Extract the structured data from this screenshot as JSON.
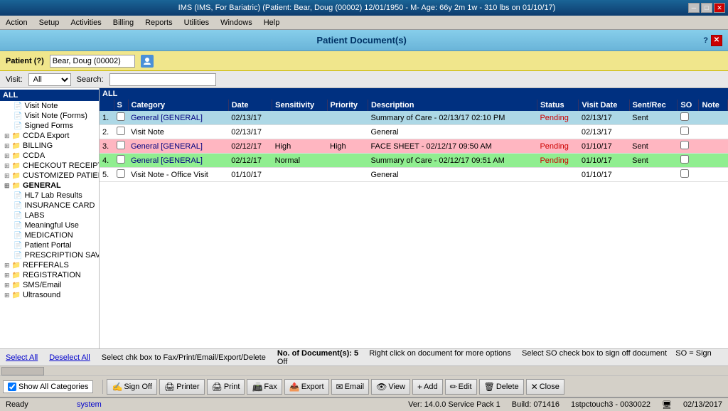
{
  "titlebar": {
    "text": "IMS (IMS, For Bariatric)   (Patient: Bear, Doug  (00002) 12/01/1950 - M- Age: 66y 2m 1w - 310 lbs on 01/10/17)",
    "minimize": "─",
    "restore": "□",
    "close": "✕"
  },
  "menubar": {
    "items": [
      "Action",
      "Setup",
      "Activities",
      "Billing",
      "Reports",
      "Utilities",
      "Windows",
      "Help"
    ]
  },
  "dialog": {
    "title": "Patient Document(s)",
    "help": "?",
    "close": "✕"
  },
  "patient": {
    "label": "Patient (?)",
    "value": "Bear, Doug (00002)"
  },
  "visit": {
    "label": "Visit:",
    "value": "All",
    "search_label": "Search:",
    "search_value": ""
  },
  "sidebar": {
    "all_label": "ALL",
    "items": [
      {
        "label": "Visit Note",
        "indent": 1,
        "bold": false
      },
      {
        "label": "Visit Note (Forms)",
        "indent": 1,
        "bold": false
      },
      {
        "label": "Signed Forms",
        "indent": 1,
        "bold": false
      },
      {
        "label": "CCDA Export",
        "indent": 0,
        "bold": false
      },
      {
        "label": "BILLING",
        "indent": 0,
        "bold": false
      },
      {
        "label": "CCDA",
        "indent": 0,
        "bold": false
      },
      {
        "label": "CHECKOUT RECEIPT",
        "indent": 0,
        "bold": false
      },
      {
        "label": "CUSTOMIZED PATIENT",
        "indent": 0,
        "bold": false
      },
      {
        "label": "GENERAL",
        "indent": 0,
        "bold": true
      },
      {
        "label": "HL7 Lab Results",
        "indent": 1,
        "bold": false
      },
      {
        "label": "INSURANCE CARD",
        "indent": 1,
        "bold": false
      },
      {
        "label": "LABS",
        "indent": 1,
        "bold": false
      },
      {
        "label": "Meaningful Use",
        "indent": 1,
        "bold": false
      },
      {
        "label": "MEDICATION",
        "indent": 1,
        "bold": false
      },
      {
        "label": "Patient Portal",
        "indent": 1,
        "bold": false
      },
      {
        "label": "PRESCRIPTION SAVING",
        "indent": 1,
        "bold": false
      },
      {
        "label": "REFFERALS",
        "indent": 0,
        "bold": false
      },
      {
        "label": "REGISTRATION",
        "indent": 0,
        "bold": false
      },
      {
        "label": "SMS/Email",
        "indent": 0,
        "bold": false
      },
      {
        "label": "Ultrasound",
        "indent": 0,
        "bold": false
      }
    ]
  },
  "table": {
    "all_label": "ALL",
    "columns": [
      "",
      "S",
      "Category",
      "Date",
      "Sensitivity",
      "Priority",
      "Description",
      "Status",
      "Visit Date",
      "Sent/Rec",
      "SO",
      "Note"
    ],
    "rows": [
      {
        "num": "1.",
        "checked": false,
        "category": "General [GENERAL]",
        "date": "02/13/17",
        "sensitivity": "",
        "priority": "",
        "description": "Summary of Care - 02/13/17 02:10 PM",
        "status": "Pending",
        "visit_date": "02/13/17",
        "sent_rec": "Sent",
        "so": false,
        "note": "",
        "color": "blue"
      },
      {
        "num": "2.",
        "checked": false,
        "category": "Visit Note",
        "date": "02/13/17",
        "sensitivity": "",
        "priority": "",
        "description": "General",
        "status": "",
        "visit_date": "02/13/17",
        "sent_rec": "",
        "so": false,
        "note": "",
        "color": "white"
      },
      {
        "num": "3.",
        "checked": false,
        "category": "General [GENERAL]",
        "date": "02/12/17",
        "sensitivity": "High",
        "priority": "High",
        "description": "FACE SHEET - 02/12/17 09:50 AM",
        "status": "Pending",
        "visit_date": "01/10/17",
        "sent_rec": "Sent",
        "so": false,
        "note": "",
        "color": "pink"
      },
      {
        "num": "4.",
        "checked": false,
        "category": "General [GENERAL]",
        "date": "02/12/17",
        "sensitivity": "Normal",
        "priority": "",
        "description": "Summary of Care - 02/12/17 09:51 AM",
        "status": "Pending",
        "visit_date": "01/10/17",
        "sent_rec": "Sent",
        "so": false,
        "note": "",
        "color": "green"
      },
      {
        "num": "5.",
        "checked": false,
        "category": "Visit Note - Office Visit",
        "date": "01/10/17",
        "sensitivity": "",
        "priority": "",
        "description": "General",
        "status": "",
        "visit_date": "01/10/17",
        "sent_rec": "",
        "so": false,
        "note": "",
        "color": "white"
      }
    ]
  },
  "status_bar": {
    "select_all": "Select All",
    "deselect_all": "Deselect All",
    "instruction": "Select chk box to Fax/Print/Email/Export/Delete",
    "count_label": "No. of Document(s):",
    "count": "5",
    "right_click_info": "Right click on document for more options",
    "so_info": "Select SO check box to sign off document",
    "so_legend": "SO = Sign Off"
  },
  "buttons": [
    {
      "label": "Show All Categories",
      "icon": "☑",
      "name": "show-all-categories"
    },
    {
      "label": "Sign Off",
      "icon": "✍",
      "name": "sign-off"
    },
    {
      "label": "Printer",
      "icon": "🖨",
      "name": "printer"
    },
    {
      "label": "Print",
      "icon": "🖨",
      "name": "print"
    },
    {
      "label": "Fax",
      "icon": "📠",
      "name": "fax"
    },
    {
      "label": "Export",
      "icon": "📤",
      "name": "export"
    },
    {
      "label": "Email",
      "icon": "✉",
      "name": "email"
    },
    {
      "label": "View",
      "icon": "👁",
      "name": "view"
    },
    {
      "label": "Add",
      "icon": "+",
      "name": "add"
    },
    {
      "label": "Edit",
      "icon": "✏",
      "name": "edit"
    },
    {
      "label": "Delete",
      "icon": "🗑",
      "name": "delete"
    },
    {
      "label": "Close",
      "icon": "✕",
      "name": "close-dialog"
    }
  ],
  "bottom_status": {
    "left": "Ready",
    "system": "system",
    "version": "Ver: 14.0.0 Service Pack 1",
    "build": "Build: 071416",
    "server": "1stpctouch3 - 0030022",
    "date": "02/13/2017"
  }
}
